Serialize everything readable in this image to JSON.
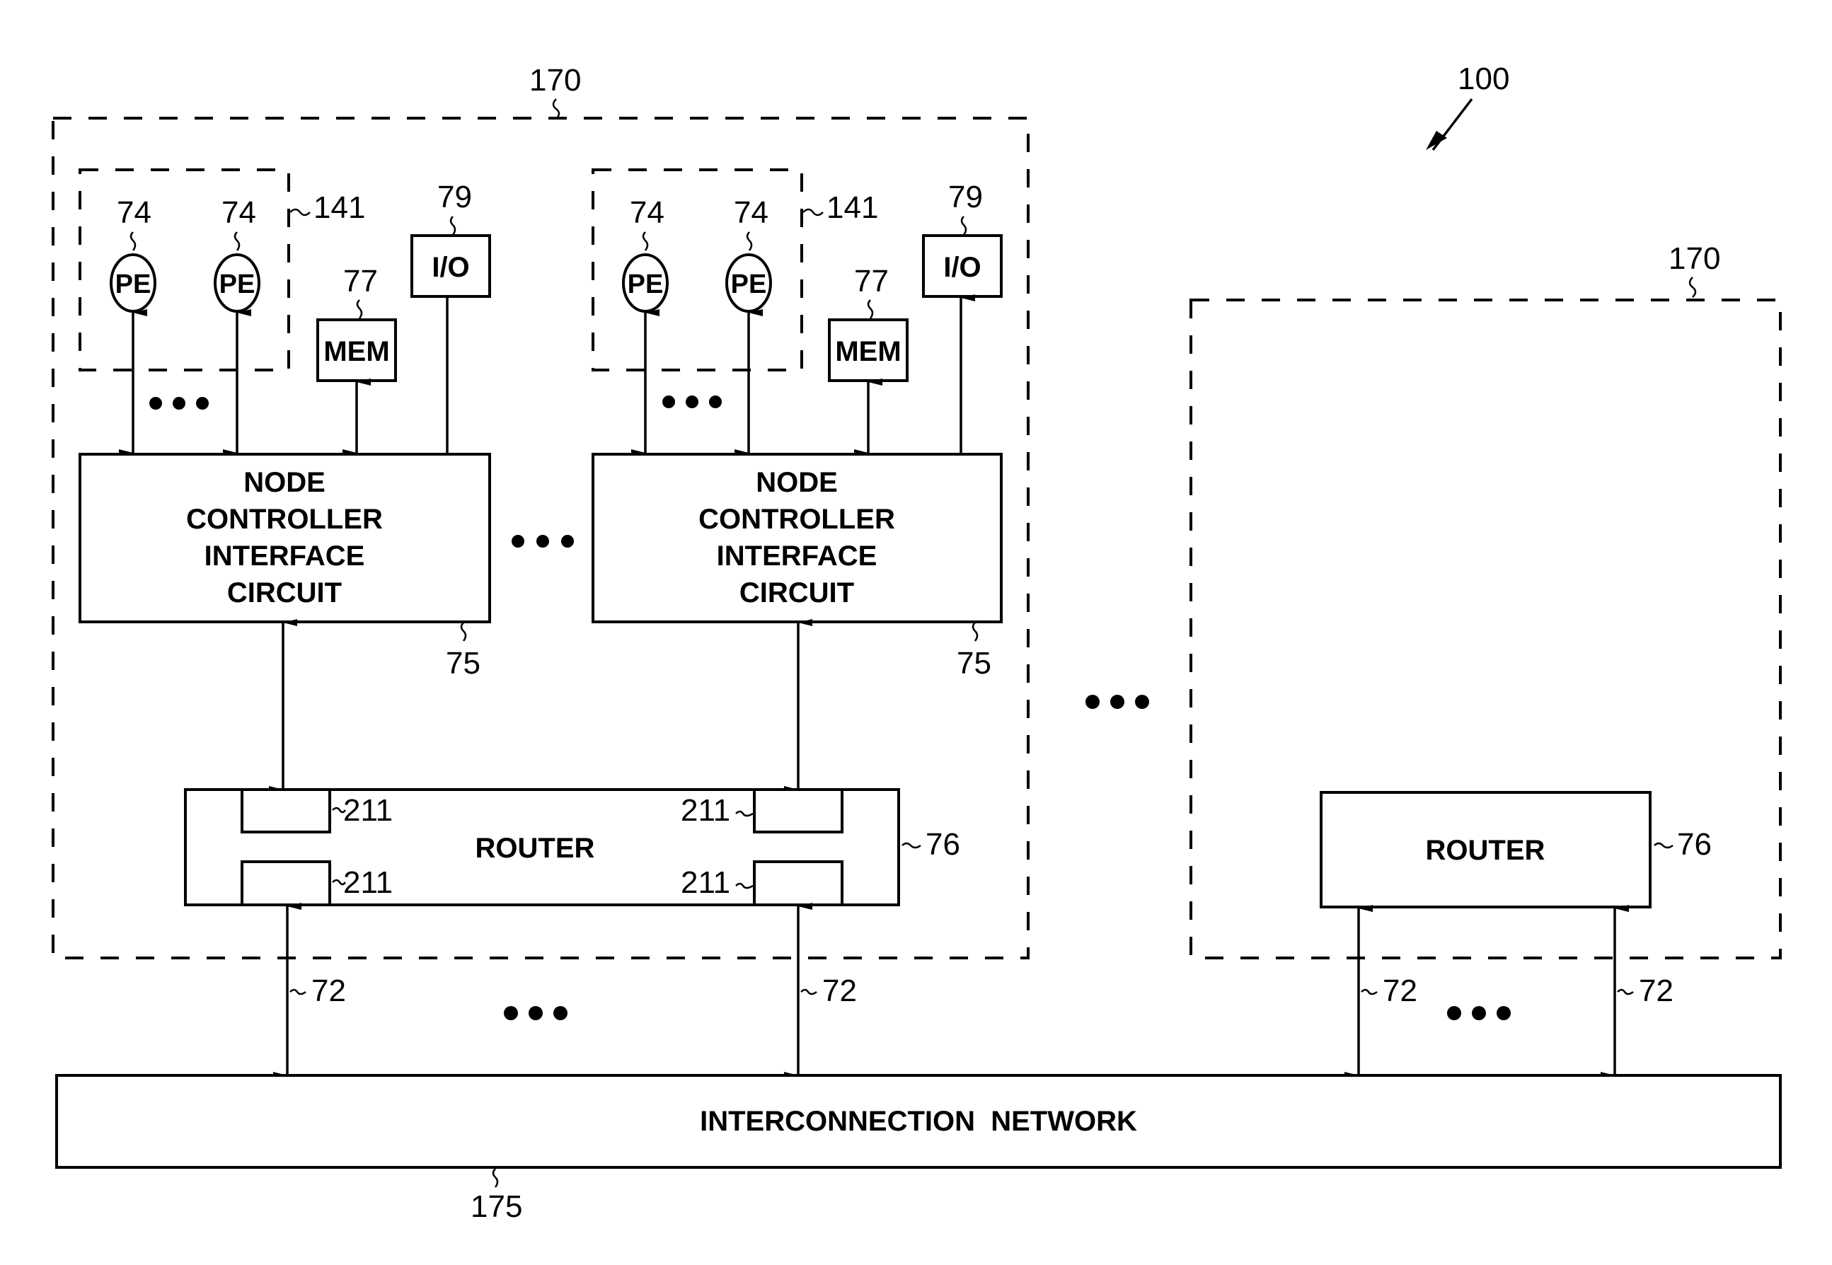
{
  "figure": {
    "system_ref": "100",
    "nodes": [
      {
        "ref": "170",
        "pe_group_ref": "141",
        "pe_ref": "74",
        "pe_label": "PE",
        "mem_ref": "77",
        "mem_label": "MEM",
        "io_ref": "79",
        "io_label": "I/O",
        "controller_ref": "75",
        "controller_lines": [
          "NODE",
          "CONTROLLER",
          "INTERFACE",
          "CIRCUIT"
        ]
      },
      {
        "ref": "170",
        "pe_group_ref": "141",
        "pe_ref": "74",
        "pe_label": "PE",
        "mem_ref": "77",
        "mem_label": "MEM",
        "io_ref": "79",
        "io_label": "I/O",
        "controller_ref": "75",
        "controller_lines": [
          "NODE",
          "CONTROLLER",
          "INTERFACE",
          "CIRCUIT"
        ]
      }
    ],
    "router": {
      "label": "ROUTER",
      "ref": "76",
      "port_ref": "211"
    },
    "remote_node": {
      "ref": "170",
      "router_label": "ROUTER",
      "router_ref": "76"
    },
    "link_ref": "72",
    "network": {
      "label": "INTERCONNECTION  NETWORK",
      "ref": "175"
    },
    "ellipsis": "•••"
  }
}
